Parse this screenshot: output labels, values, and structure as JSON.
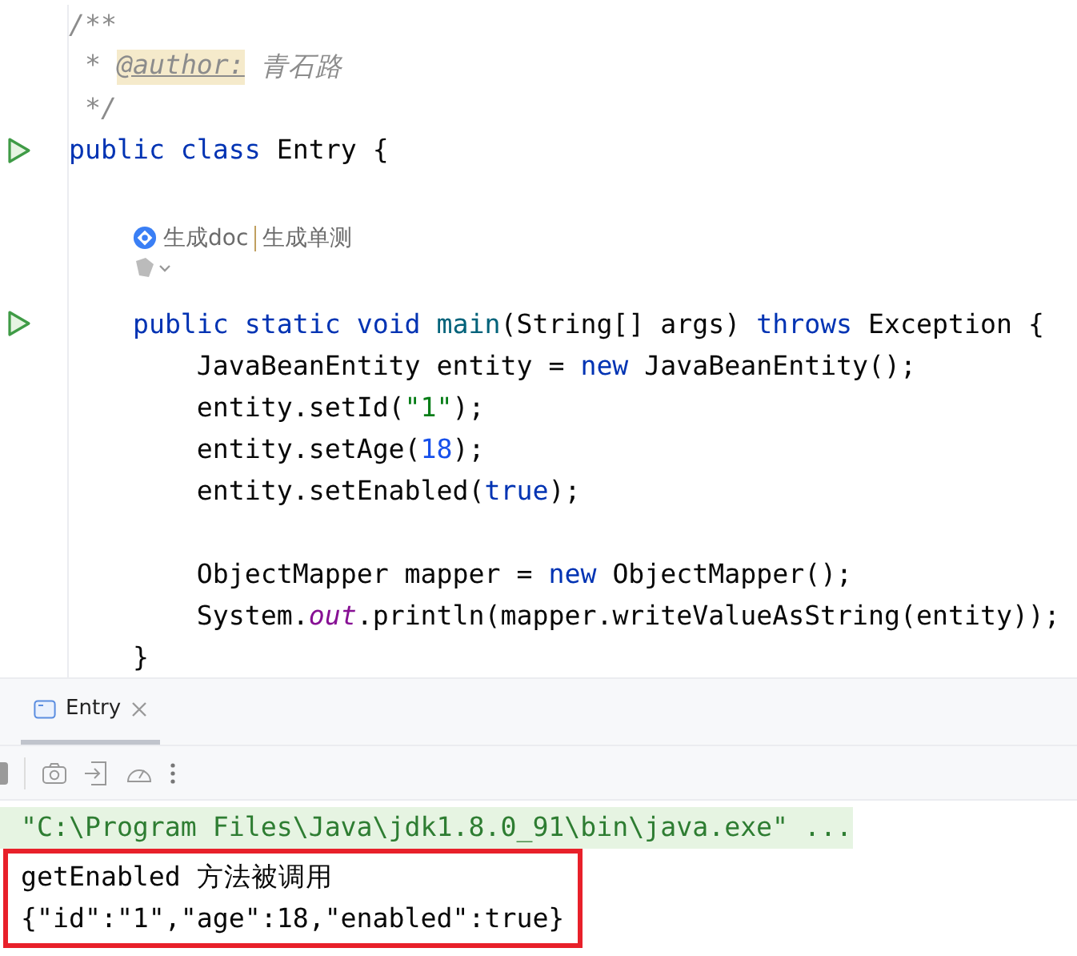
{
  "editor": {
    "lines": [
      {
        "run": false,
        "tokens": [
          {
            "kind": "comment",
            "text": "/**"
          }
        ]
      },
      {
        "run": false,
        "tokens": [
          {
            "kind": "comment",
            "text": " * "
          },
          {
            "kind": "doctag",
            "text": "@author:"
          },
          {
            "kind": "comment",
            "text": " 青石路"
          }
        ]
      },
      {
        "run": false,
        "tokens": [
          {
            "kind": "comment",
            "text": " */"
          }
        ]
      },
      {
        "run": true,
        "tokens": [
          {
            "kind": "keyword",
            "text": "public class"
          },
          {
            "kind": "plain",
            "text": " Entry {"
          }
        ]
      },
      {
        "kind": "blank"
      },
      {
        "kind": "hint",
        "actions": [
          "生成doc",
          "生成单测"
        ]
      },
      {
        "run": true,
        "tokens": [
          {
            "kind": "keyword",
            "text": "    public static void"
          },
          {
            "kind": "method",
            "text": " main"
          },
          {
            "kind": "plain",
            "text": "(String[] args) "
          },
          {
            "kind": "keyword",
            "text": "throws"
          },
          {
            "kind": "plain",
            "text": " Exception {"
          }
        ]
      },
      {
        "run": false,
        "tokens": [
          {
            "kind": "plain",
            "text": "        JavaBeanEntity entity = "
          },
          {
            "kind": "keyword",
            "text": "new"
          },
          {
            "kind": "plain",
            "text": " JavaBeanEntity();"
          }
        ]
      },
      {
        "run": false,
        "tokens": [
          {
            "kind": "plain",
            "text": "        entity.setId("
          },
          {
            "kind": "string",
            "text": "\"1\""
          },
          {
            "kind": "plain",
            "text": ");"
          }
        ]
      },
      {
        "run": false,
        "tokens": [
          {
            "kind": "plain",
            "text": "        entity.setAge("
          },
          {
            "kind": "number",
            "text": "18"
          },
          {
            "kind": "plain",
            "text": ");"
          }
        ]
      },
      {
        "run": false,
        "tokens": [
          {
            "kind": "plain",
            "text": "        entity.setEnabled("
          },
          {
            "kind": "keyword",
            "text": "true"
          },
          {
            "kind": "plain",
            "text": ");"
          }
        ]
      },
      {
        "kind": "blank"
      },
      {
        "run": false,
        "tokens": [
          {
            "kind": "plain",
            "text": "        ObjectMapper mapper = "
          },
          {
            "kind": "keyword",
            "text": "new"
          },
          {
            "kind": "plain",
            "text": " ObjectMapper();"
          }
        ]
      },
      {
        "run": false,
        "tokens": [
          {
            "kind": "plain",
            "text": "        System."
          },
          {
            "kind": "field",
            "text": "out"
          },
          {
            "kind": "plain",
            "text": ".println(mapper.writeValueAsString(entity));"
          }
        ]
      },
      {
        "run": false,
        "tokens": [
          {
            "kind": "plain",
            "text": "    }"
          }
        ]
      }
    ]
  },
  "run_panel": {
    "tabs": [
      {
        "label": "Entry",
        "selected": true
      }
    ],
    "command": "\"C:\\Program Files\\Java\\jdk1.8.0_91\\bin\\java.exe\" ...",
    "output": [
      "getEnabled 方法被调用",
      "{\"id\":\"1\",\"age\":18,\"enabled\":true}"
    ]
  }
}
